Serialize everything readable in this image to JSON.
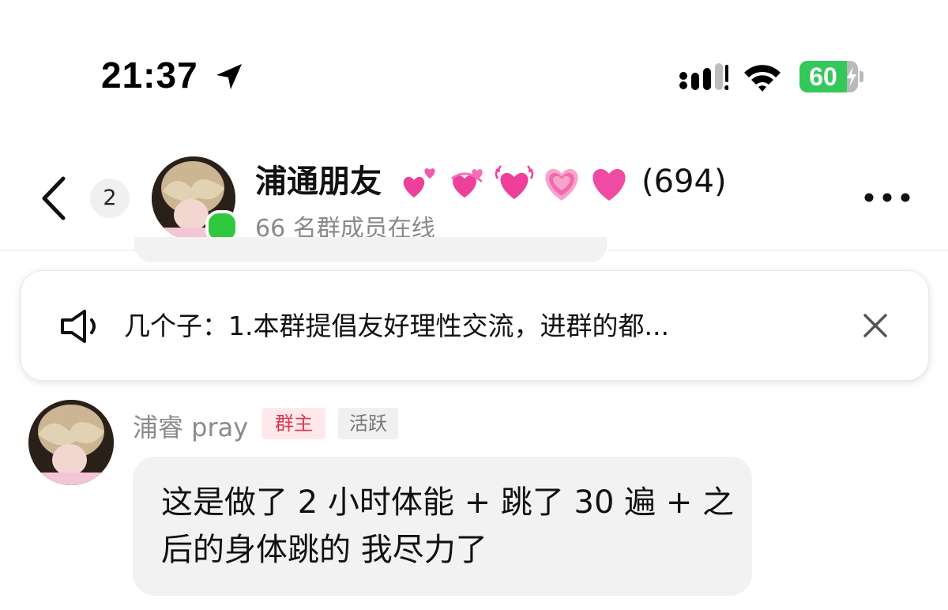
{
  "status_bar": {
    "time": "21:37",
    "battery_level": 60,
    "battery_text": "60",
    "battery_color": "#34c759",
    "icons": [
      "location-arrow-icon",
      "cellular-signal-icon",
      "wifi-icon",
      "battery-icon",
      "charging-bolt-icon"
    ]
  },
  "header": {
    "back_icon": "chevron-left-icon",
    "unread_count": "2",
    "group_name": "浦通朋友",
    "title_emojis": [
      "two-hearts",
      "revolving-hearts",
      "beating-heart",
      "growing-heart",
      "pink-heart"
    ],
    "member_count": "(694)",
    "online_status": "66 名群成员在线",
    "more_icon": "more-dots-icon",
    "online_color": "#2fc83e"
  },
  "announcement": {
    "icon": "speaker-icon",
    "text": "几个子：1.本群提倡友好理性交流，进群的都...",
    "close_icon": "close-icon"
  },
  "message": {
    "sender_name": "浦睿 pray",
    "role_badge": "群主",
    "level_badge": "活跃",
    "text": "这是做了 2 小时体能 + 跳了 30 遍 + 之后的身体跳的 我尽力了",
    "role_color": "#e0364f"
  }
}
